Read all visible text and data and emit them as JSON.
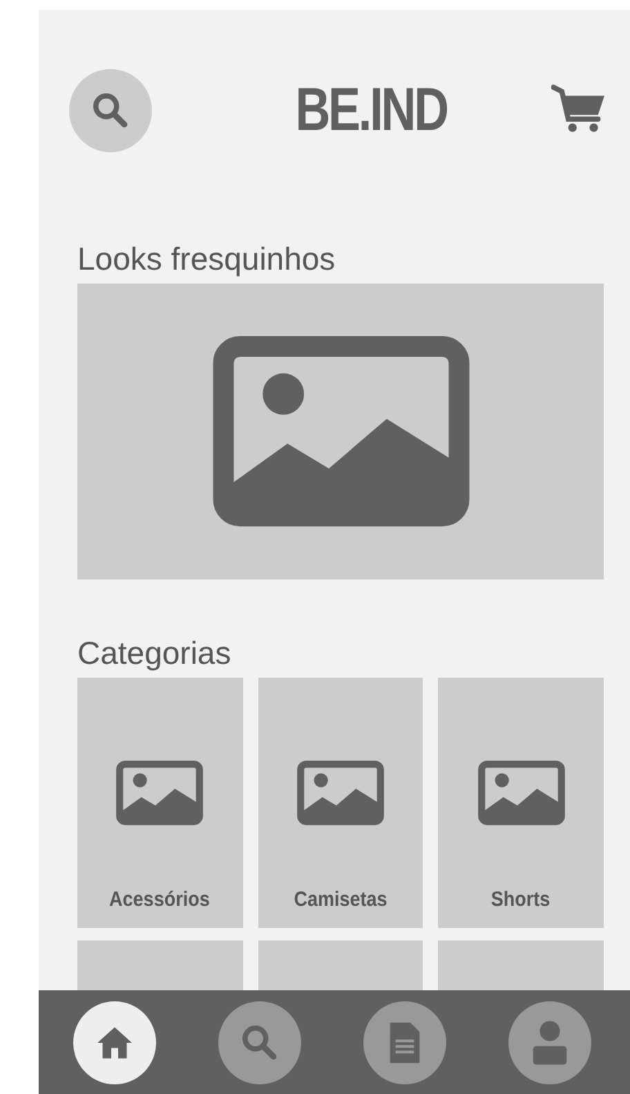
{
  "header": {
    "logo": "BE.IND"
  },
  "featured": {
    "title": "Looks fresquinhos"
  },
  "categories": {
    "title": "Categorias",
    "items": [
      {
        "kind": "tile",
        "label": "Acessórios"
      },
      {
        "kind": "tile",
        "label": "Camisetas"
      },
      {
        "kind": "tile",
        "label": "Shorts"
      },
      {
        "kind": "partial"
      },
      {
        "kind": "partial"
      },
      {
        "kind": "partial"
      }
    ]
  },
  "nav": [
    {
      "kind": "home",
      "selected": true
    },
    {
      "kind": "search",
      "selected": false
    },
    {
      "kind": "document",
      "selected": false
    },
    {
      "kind": "profile",
      "selected": false
    }
  ]
}
